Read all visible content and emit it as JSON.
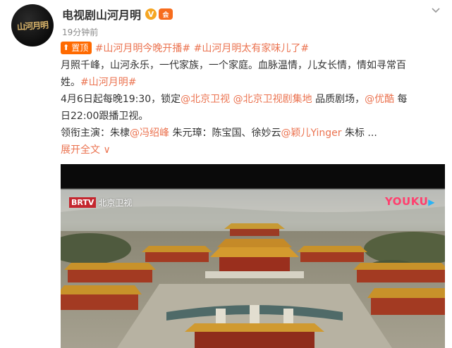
{
  "post": {
    "account_name": "电视剧山河月明",
    "avatar_text": "山河月明",
    "time": "19分钟前",
    "pin_label": "置顶",
    "hashtag_1": "#山河月明今晚开播#",
    "hashtag_2": "#山河月明太有家味儿了#",
    "line2": "月照千峰，山河永乐，一代家族，一个家庭。血脉温情，儿女长情，情如寻常百",
    "line3_text": "姓。",
    "hashtag_3": "#山河月明#",
    "line4_a": "4月6日起每晚19:30，锁定",
    "mention_bjtv": "@北京卫视",
    "mention_bjtv_series": "@北京卫视剧集地",
    "line4_b": " 品质剧场，",
    "mention_youku": "@优酷",
    "line4_c": " 每",
    "line5": "日22:00跟播卫视。",
    "line6_a": "领衔主演：朱棣",
    "mention_actor1": "@冯绍峰",
    "line6_b": " 朱元璋：陈宝国、徐妙云",
    "mention_actor2": "@颖儿Yinger",
    "line6_c": " 朱标 ...",
    "expand_label": "展开全文",
    "expand_arrow": "∨"
  },
  "media": {
    "broadcaster_logo": "BRTV",
    "broadcaster_name": "北京卫视",
    "streaming_logo": "YOUKU",
    "streaming_arrow": "▶"
  },
  "icons": {
    "verified": "V",
    "member": "会",
    "pin": "⬆"
  },
  "colors": {
    "link": "#eb7350",
    "pin_badge": "#ff6a00",
    "verified": "#f5a623",
    "brtv_red": "#c4262e",
    "youku_pink": "#ff3f6e",
    "youku_blue": "#2ab3f5"
  }
}
